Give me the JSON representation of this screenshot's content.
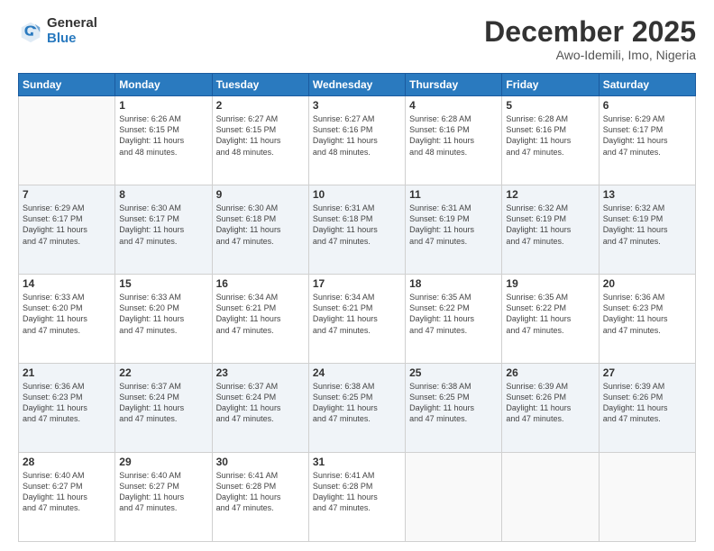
{
  "logo": {
    "general": "General",
    "blue": "Blue"
  },
  "header": {
    "month": "December 2025",
    "location": "Awo-Idemili, Imo, Nigeria"
  },
  "days_of_week": [
    "Sunday",
    "Monday",
    "Tuesday",
    "Wednesday",
    "Thursday",
    "Friday",
    "Saturday"
  ],
  "weeks": [
    [
      {
        "day": "",
        "info": ""
      },
      {
        "day": "1",
        "info": "Sunrise: 6:26 AM\nSunset: 6:15 PM\nDaylight: 11 hours\nand 48 minutes."
      },
      {
        "day": "2",
        "info": "Sunrise: 6:27 AM\nSunset: 6:15 PM\nDaylight: 11 hours\nand 48 minutes."
      },
      {
        "day": "3",
        "info": "Sunrise: 6:27 AM\nSunset: 6:16 PM\nDaylight: 11 hours\nand 48 minutes."
      },
      {
        "day": "4",
        "info": "Sunrise: 6:28 AM\nSunset: 6:16 PM\nDaylight: 11 hours\nand 48 minutes."
      },
      {
        "day": "5",
        "info": "Sunrise: 6:28 AM\nSunset: 6:16 PM\nDaylight: 11 hours\nand 47 minutes."
      },
      {
        "day": "6",
        "info": "Sunrise: 6:29 AM\nSunset: 6:17 PM\nDaylight: 11 hours\nand 47 minutes."
      }
    ],
    [
      {
        "day": "7",
        "info": "Sunrise: 6:29 AM\nSunset: 6:17 PM\nDaylight: 11 hours\nand 47 minutes."
      },
      {
        "day": "8",
        "info": "Sunrise: 6:30 AM\nSunset: 6:17 PM\nDaylight: 11 hours\nand 47 minutes."
      },
      {
        "day": "9",
        "info": "Sunrise: 6:30 AM\nSunset: 6:18 PM\nDaylight: 11 hours\nand 47 minutes."
      },
      {
        "day": "10",
        "info": "Sunrise: 6:31 AM\nSunset: 6:18 PM\nDaylight: 11 hours\nand 47 minutes."
      },
      {
        "day": "11",
        "info": "Sunrise: 6:31 AM\nSunset: 6:19 PM\nDaylight: 11 hours\nand 47 minutes."
      },
      {
        "day": "12",
        "info": "Sunrise: 6:32 AM\nSunset: 6:19 PM\nDaylight: 11 hours\nand 47 minutes."
      },
      {
        "day": "13",
        "info": "Sunrise: 6:32 AM\nSunset: 6:19 PM\nDaylight: 11 hours\nand 47 minutes."
      }
    ],
    [
      {
        "day": "14",
        "info": "Sunrise: 6:33 AM\nSunset: 6:20 PM\nDaylight: 11 hours\nand 47 minutes."
      },
      {
        "day": "15",
        "info": "Sunrise: 6:33 AM\nSunset: 6:20 PM\nDaylight: 11 hours\nand 47 minutes."
      },
      {
        "day": "16",
        "info": "Sunrise: 6:34 AM\nSunset: 6:21 PM\nDaylight: 11 hours\nand 47 minutes."
      },
      {
        "day": "17",
        "info": "Sunrise: 6:34 AM\nSunset: 6:21 PM\nDaylight: 11 hours\nand 47 minutes."
      },
      {
        "day": "18",
        "info": "Sunrise: 6:35 AM\nSunset: 6:22 PM\nDaylight: 11 hours\nand 47 minutes."
      },
      {
        "day": "19",
        "info": "Sunrise: 6:35 AM\nSunset: 6:22 PM\nDaylight: 11 hours\nand 47 minutes."
      },
      {
        "day": "20",
        "info": "Sunrise: 6:36 AM\nSunset: 6:23 PM\nDaylight: 11 hours\nand 47 minutes."
      }
    ],
    [
      {
        "day": "21",
        "info": "Sunrise: 6:36 AM\nSunset: 6:23 PM\nDaylight: 11 hours\nand 47 minutes."
      },
      {
        "day": "22",
        "info": "Sunrise: 6:37 AM\nSunset: 6:24 PM\nDaylight: 11 hours\nand 47 minutes."
      },
      {
        "day": "23",
        "info": "Sunrise: 6:37 AM\nSunset: 6:24 PM\nDaylight: 11 hours\nand 47 minutes."
      },
      {
        "day": "24",
        "info": "Sunrise: 6:38 AM\nSunset: 6:25 PM\nDaylight: 11 hours\nand 47 minutes."
      },
      {
        "day": "25",
        "info": "Sunrise: 6:38 AM\nSunset: 6:25 PM\nDaylight: 11 hours\nand 47 minutes."
      },
      {
        "day": "26",
        "info": "Sunrise: 6:39 AM\nSunset: 6:26 PM\nDaylight: 11 hours\nand 47 minutes."
      },
      {
        "day": "27",
        "info": "Sunrise: 6:39 AM\nSunset: 6:26 PM\nDaylight: 11 hours\nand 47 minutes."
      }
    ],
    [
      {
        "day": "28",
        "info": "Sunrise: 6:40 AM\nSunset: 6:27 PM\nDaylight: 11 hours\nand 47 minutes."
      },
      {
        "day": "29",
        "info": "Sunrise: 6:40 AM\nSunset: 6:27 PM\nDaylight: 11 hours\nand 47 minutes."
      },
      {
        "day": "30",
        "info": "Sunrise: 6:41 AM\nSunset: 6:28 PM\nDaylight: 11 hours\nand 47 minutes."
      },
      {
        "day": "31",
        "info": "Sunrise: 6:41 AM\nSunset: 6:28 PM\nDaylight: 11 hours\nand 47 minutes."
      },
      {
        "day": "",
        "info": ""
      },
      {
        "day": "",
        "info": ""
      },
      {
        "day": "",
        "info": ""
      }
    ]
  ]
}
